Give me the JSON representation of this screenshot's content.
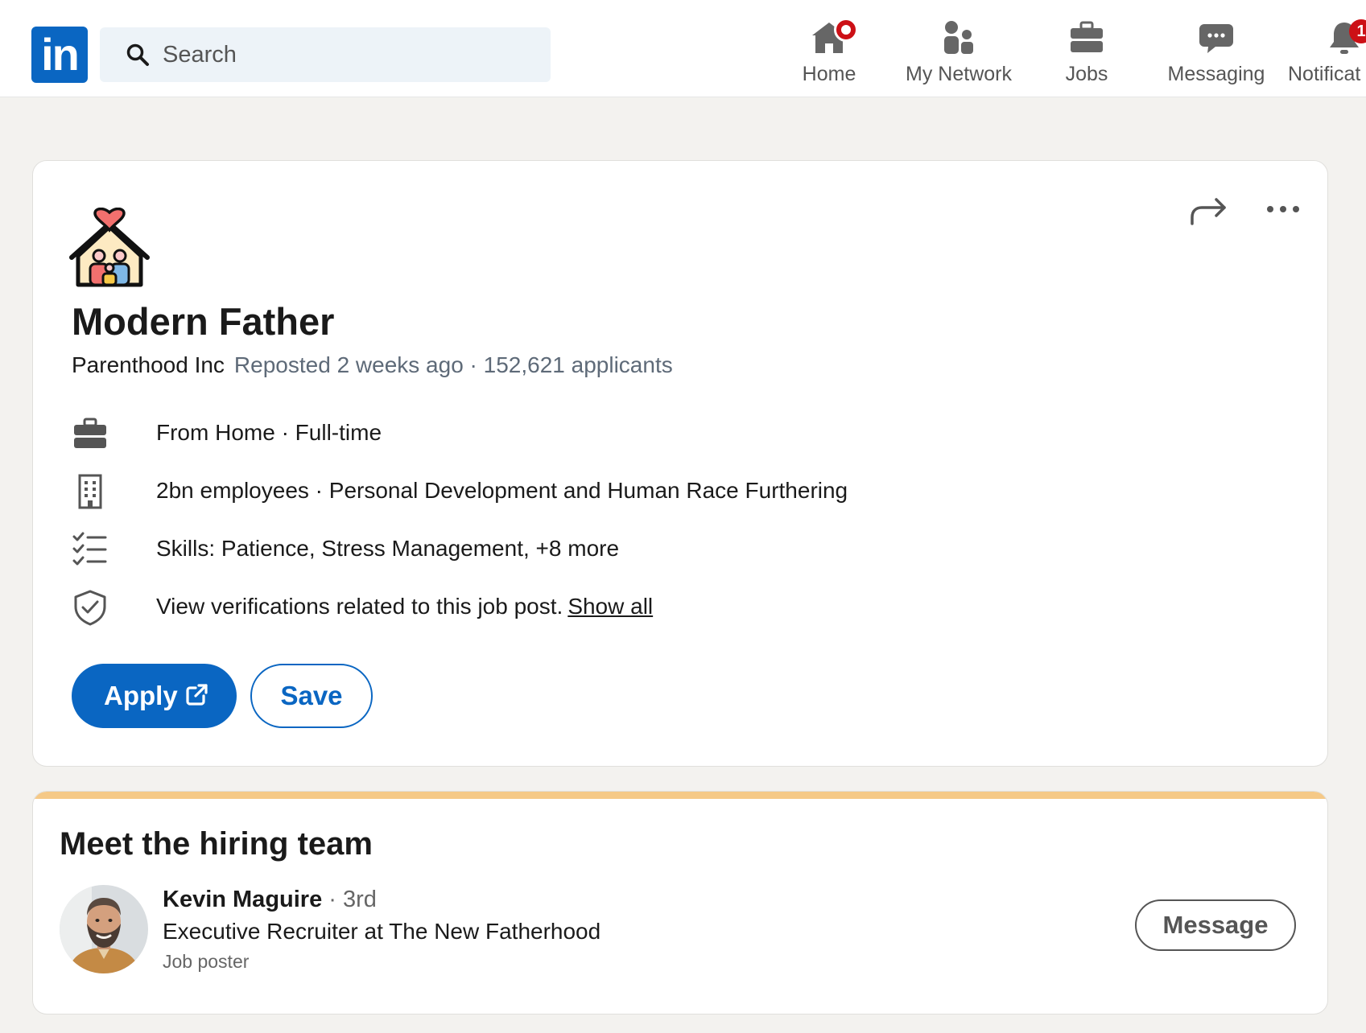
{
  "nav": {
    "logo_text": "in",
    "search_placeholder": "Search",
    "items": [
      {
        "label": "Home",
        "icon": "home-icon"
      },
      {
        "label": "My Network",
        "icon": "network-icon"
      },
      {
        "label": "Jobs",
        "icon": "briefcase-icon"
      },
      {
        "label": "Messaging",
        "icon": "chat-icon"
      },
      {
        "label": "Notificat",
        "icon": "bell-icon",
        "badge": "1"
      }
    ]
  },
  "job": {
    "title": "Modern Father",
    "company": "Parenthood Inc",
    "meta": "Reposted 2 weeks ago · 152,621 applicants",
    "rows": [
      {
        "icon": "briefcase-icon",
        "text": "From Home · Full-time"
      },
      {
        "icon": "building-icon",
        "text": "2bn employees · Personal Development and Human Race Furthering"
      },
      {
        "icon": "checklist-icon",
        "text": "Skills: Patience, Stress Management, +8 more"
      },
      {
        "icon": "shield-check-icon",
        "text": "View verifications related to this job post.",
        "link": "Show all"
      }
    ],
    "apply_label": "Apply",
    "save_label": "Save"
  },
  "hiring_team": {
    "title": "Meet the hiring team",
    "name": "Kevin Maguire",
    "degree": " · 3rd",
    "role": "Executive Recruiter at The New Fatherhood",
    "tag": "Job poster",
    "message_label": "Message"
  },
  "colors": {
    "brand": "#0a66c2",
    "badge": "#cc1016",
    "stripe": "#f5c987",
    "background": "#f3f2ef"
  }
}
